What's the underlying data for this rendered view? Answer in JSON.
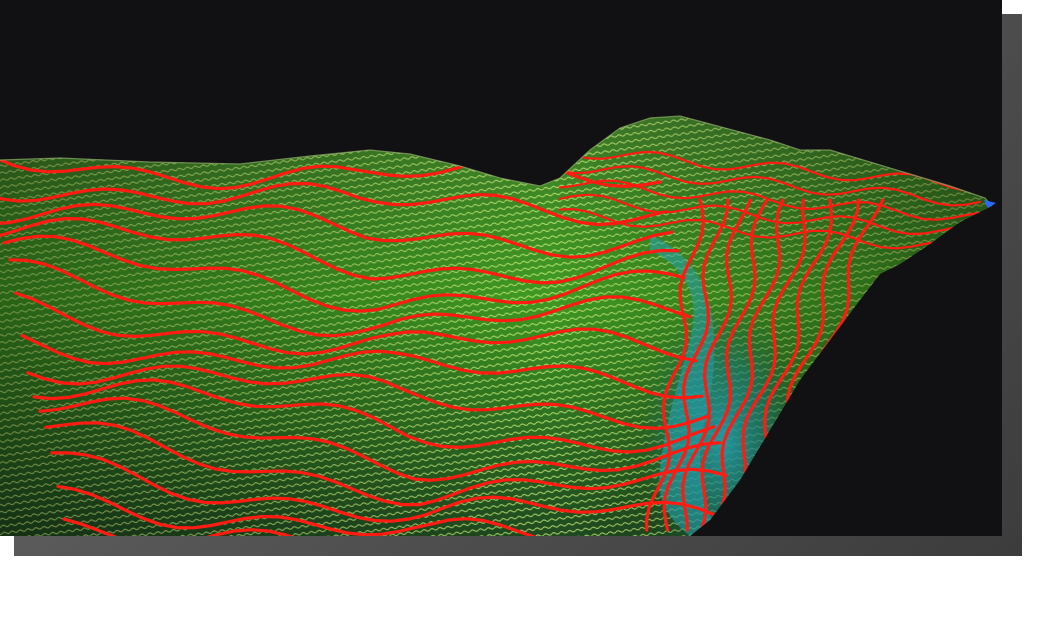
{
  "scene": {
    "subject": "terrain-3d-contour-rendering",
    "background_color": "#111012",
    "frame_shadow_color": "#4a4a4a",
    "colors": {
      "terrain_low": "#1f6a45",
      "terrain_mid": "#3f9a22",
      "terrain_high": "#7fd03a",
      "valley_water": "#2ab5c5",
      "index_contour": "#ff1a12",
      "minor_contour": "#c8f07a"
    }
  }
}
